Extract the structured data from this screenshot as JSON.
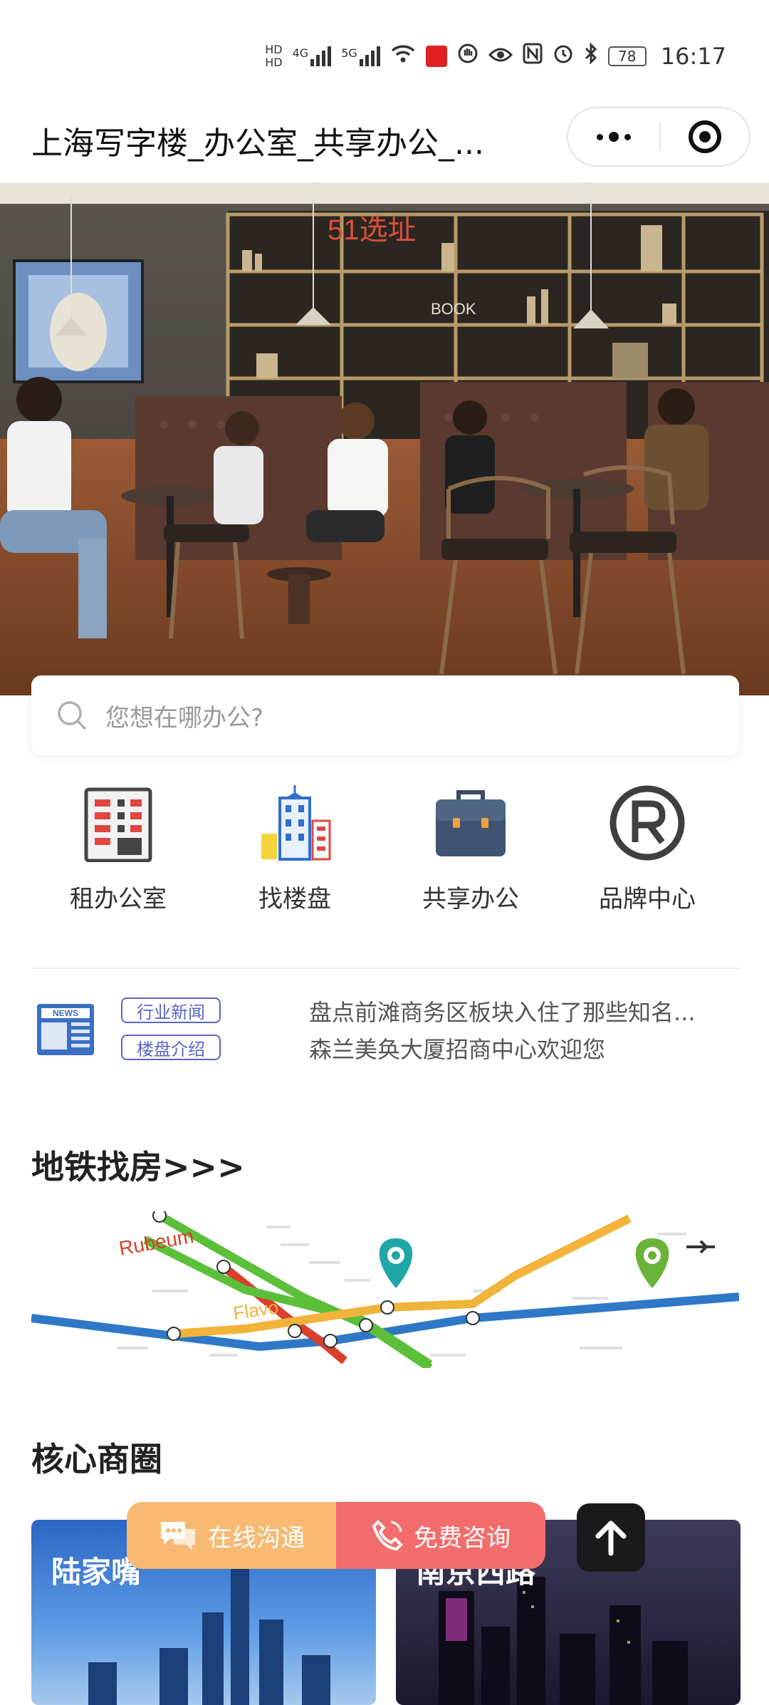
{
  "status_bar": {
    "hd_top": "HD",
    "hd_bottom": "HD",
    "signal_1": "4G",
    "signal_2": "5G",
    "battery": "78",
    "time": "16:17"
  },
  "header": {
    "title": "上海写字楼_办公室_共享办公_..."
  },
  "banner": {
    "watermark_text": "51选址",
    "sign_text": "BOOK",
    "total_slides": 2,
    "active_slide": 1
  },
  "search": {
    "placeholder": "您想在哪办公?"
  },
  "categories": [
    {
      "label": "租办公室",
      "icon": "office-building-icon"
    },
    {
      "label": "找楼盘",
      "icon": "tower-icon"
    },
    {
      "label": "共享办公",
      "icon": "briefcase-icon"
    },
    {
      "label": "品牌中心",
      "icon": "registered-icon"
    }
  ],
  "news": {
    "icon_label": "NEWS",
    "tags": [
      "行业新闻",
      "楼盘介绍"
    ],
    "items": [
      "盘点前滩商务区板块入住了那些知名...",
      "森兰美奂大厦招商中心欢迎您"
    ]
  },
  "metro": {
    "title": "地铁找房>>>",
    "map_labels": {
      "red_line": "Rubeum",
      "yellow_line": "Flavo"
    }
  },
  "business": {
    "title": "核心商圈",
    "cards": [
      {
        "name": "陆家嘴"
      },
      {
        "name": "南京西路"
      }
    ]
  },
  "floating": {
    "chat_label": "在线沟通",
    "call_label": "免费咨询"
  },
  "colors": {
    "accent_blue": "#5a66c8",
    "chat_orange": "#f8b973",
    "call_red": "#f36d6d",
    "metro_green": "#5cbf3a",
    "metro_blue": "#2e78c7",
    "metro_red": "#d8402b",
    "metro_yellow": "#f0b43a"
  }
}
